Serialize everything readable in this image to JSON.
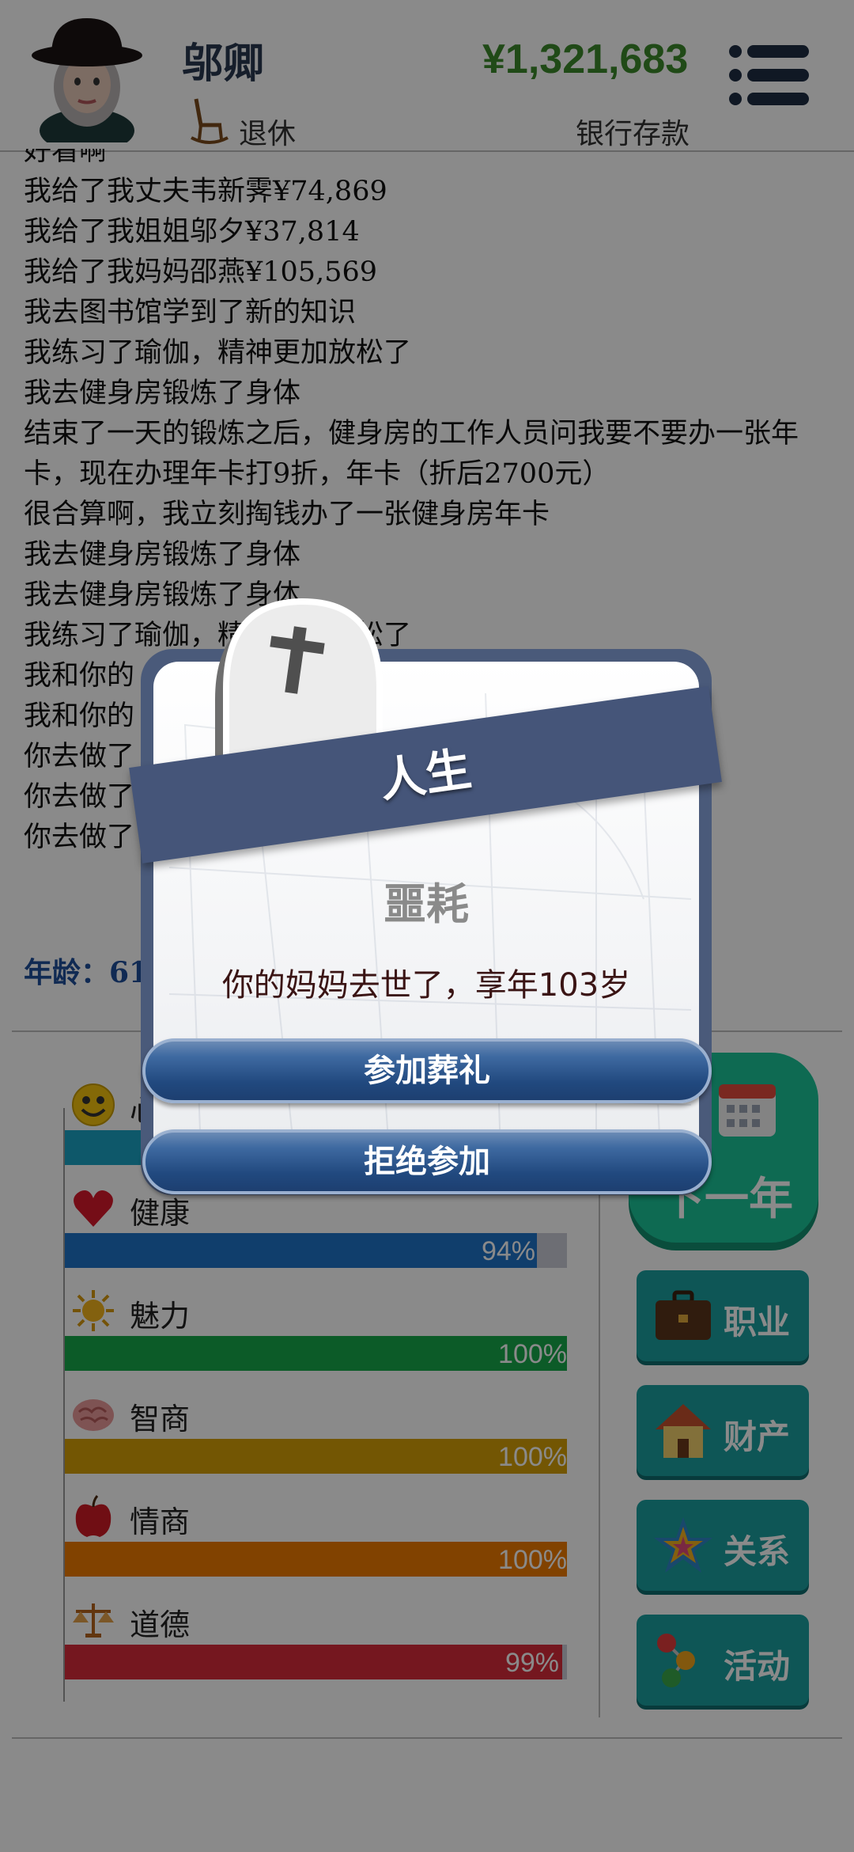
{
  "header": {
    "name": "邬卿",
    "status_label": "退休",
    "money": "¥1,321,683",
    "money_label": "银行存款"
  },
  "log": {
    "lines": [
      "好看啊",
      "我给了我丈夫韦新霁¥74,869",
      "我给了我姐姐邬夕¥37,814",
      "我给了我妈妈邵燕¥105,569",
      "我去图书馆学到了新的知识",
      "我练习了瑜伽，精神更加放松了",
      "我去健身房锻炼了身体",
      "结束了一天的锻炼之后，健身房的工作人员问我要不要办一张年卡，现在办理年卡打9折，年卡（折后2700元）",
      "很合算啊，我立刻掏钱办了一张健身房年卡",
      "我去健身房锻炼了身体",
      "我去健身房锻炼了身体",
      "我练习了瑜伽，精神更加放松了",
      "我和你的",
      "我和你的",
      "你去做了",
      "你去做了",
      "你去做了"
    ],
    "age_text": "年龄：61"
  },
  "stats": [
    {
      "label": "心情",
      "icon": "smiley-icon",
      "percent": 100,
      "color": "#1aa3c4",
      "pct_label": ""
    },
    {
      "label": "健康",
      "icon": "heart-icon",
      "percent": 94,
      "color": "#1f73c8",
      "pct_label": "94%"
    },
    {
      "label": "魅力",
      "icon": "sun-icon",
      "percent": 100,
      "color": "#17a84a",
      "pct_label": "100%"
    },
    {
      "label": "智商",
      "icon": "brain-icon",
      "percent": 100,
      "color": "#d4a007",
      "pct_label": "100%"
    },
    {
      "label": "情商",
      "icon": "apple-icon",
      "percent": 100,
      "color": "#ee7b00",
      "pct_label": "100%"
    },
    {
      "label": "道德",
      "icon": "scales-icon",
      "percent": 99,
      "color": "#d92c3a",
      "pct_label": "99%"
    }
  ],
  "actions": {
    "next_year": "下一年",
    "buttons": [
      {
        "label": "职业",
        "icon": "briefcase-icon"
      },
      {
        "label": "财产",
        "icon": "house-icon"
      },
      {
        "label": "关系",
        "icon": "star-icon"
      },
      {
        "label": "活动",
        "icon": "activity-icon"
      }
    ]
  },
  "dialog": {
    "title": "人生",
    "heading": "噩耗",
    "message": "你的妈妈去世了，享年103岁",
    "buttons": [
      "参加葬礼",
      "拒绝参加"
    ]
  }
}
